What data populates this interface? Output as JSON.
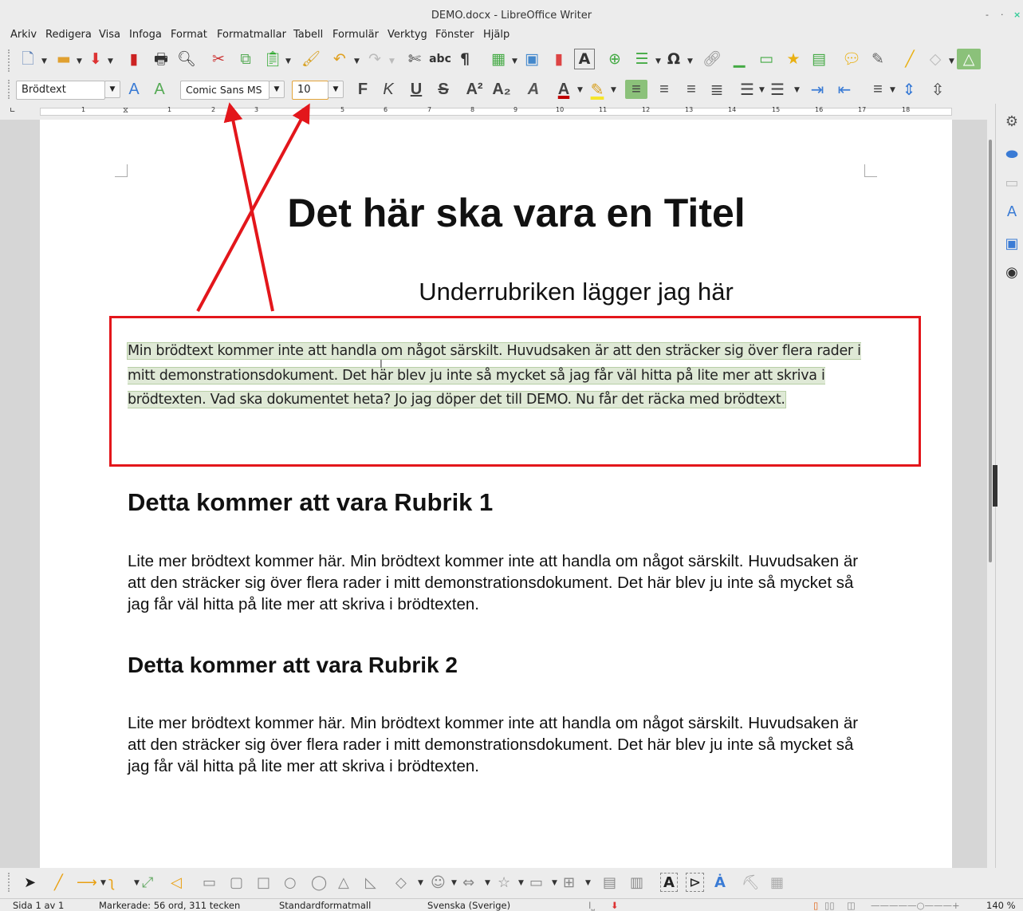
{
  "window": {
    "title": "DEMO.docx - LibreOffice Writer",
    "controls": [
      "-",
      "·",
      "×"
    ]
  },
  "menu": [
    "Arkiv",
    "Redigera",
    "Visa",
    "Infoga",
    "Format",
    "Formatmallar",
    "Tabell",
    "Formulär",
    "Verktyg",
    "Fönster",
    "Hjälp"
  ],
  "formatting": {
    "paragraph_style": "Brödtext",
    "font_name": "Comic Sans MS",
    "font_size": "10",
    "bold": "F",
    "italic": "K",
    "underline": "U",
    "strikethrough": "S",
    "superscript": "A²",
    "subscript": "A₂"
  },
  "ruler": {
    "numbers": [
      "1",
      "1",
      "2",
      "3",
      "5",
      "6",
      "7",
      "8",
      "9",
      "10",
      "11",
      "12",
      "13",
      "14",
      "15",
      "16",
      "17",
      "18"
    ]
  },
  "document": {
    "title": "Det här ska vara en Titel",
    "subtitle": "Underrubriken lägger jag här",
    "selected_paragraph": "Min brödtext kommer inte att handla om något särskilt. Huvudsaken är att den sträcker sig över flera rader i mitt demonstrationsdokument. Det här blev ju inte så mycket så jag får väl hitta på lite mer att skriva i brödtexten. Vad ska dokumentet heta? Jo jag döper det till DEMO. Nu får det räcka med brödtext.",
    "heading1": "Detta kommer att vara Rubrik 1",
    "body1": "Lite mer brödtext kommer här. Min brödtext kommer inte att handla om något särskilt. Huvudsaken är att den sträcker sig över flera rader i mitt demonstrationsdokument. Det här blev ju inte så mycket så jag får väl hitta på lite mer att skriva i brödtexten.",
    "heading2": "Detta kommer att vara Rubrik 2",
    "body2": "Lite mer brödtext kommer här. Min brödtext kommer inte att handla om något särskilt. Huvudsaken är att den sträcker sig över flera rader i mitt demonstrationsdokument. Det här blev ju inte så mycket så jag får väl hitta på lite mer att skriva i brödtexten."
  },
  "status": {
    "page": "Sida 1 av 1",
    "selection": "Markerade: 56 ord, 311 tecken",
    "page_style": "Standardformatmall",
    "language": "Svenska (Sverige)",
    "zoom": "140 %"
  },
  "colors": {
    "annotation": "#e3161b",
    "selection_highlight": "#dfe9d6",
    "font_color_bar": "#c00000",
    "highlight_bar": "#f5e52a"
  }
}
